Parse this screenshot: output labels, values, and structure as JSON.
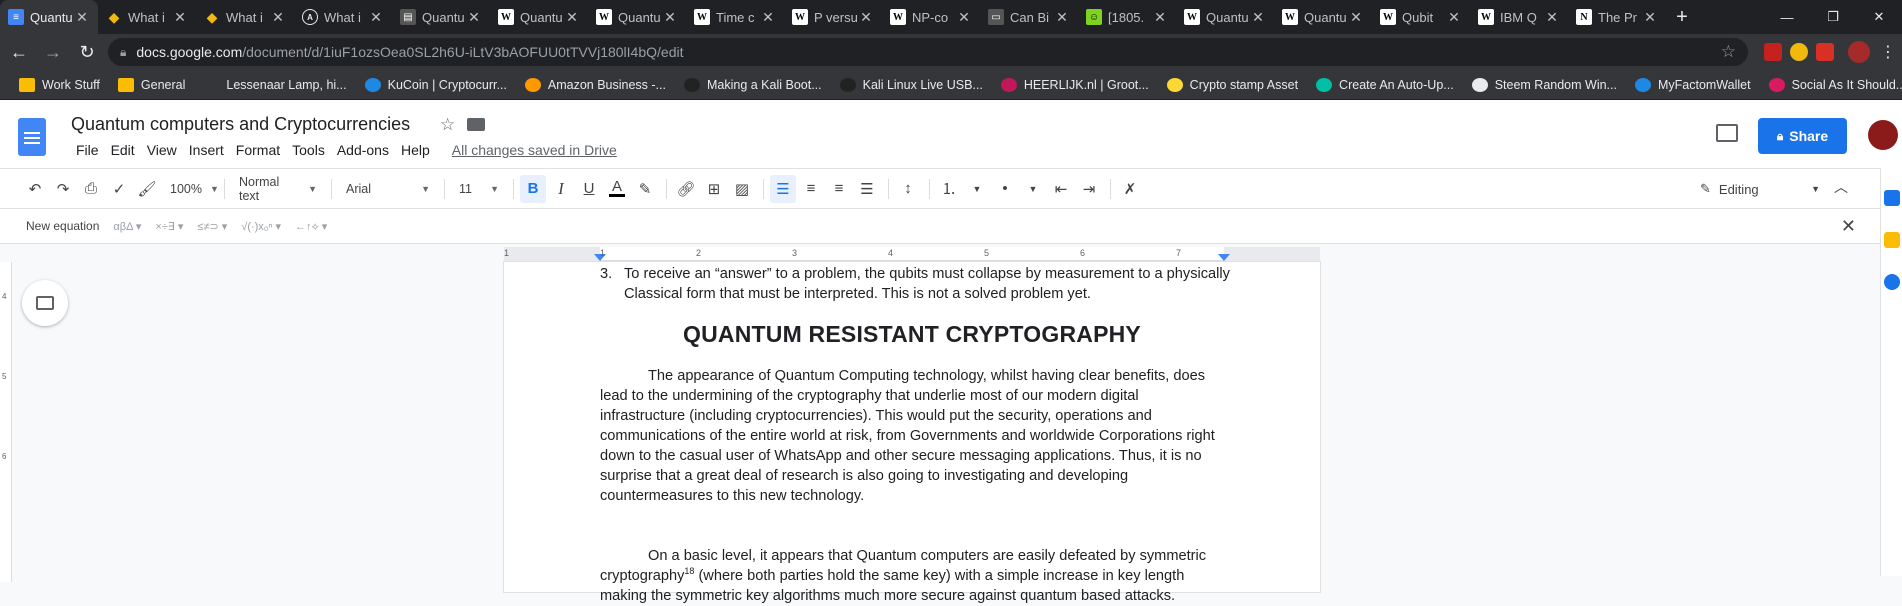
{
  "browser": {
    "tabs": [
      {
        "label": "Quantu",
        "icon": "docs-icon",
        "active": true
      },
      {
        "label": "What i",
        "icon": "binance-icon"
      },
      {
        "label": "What i",
        "icon": "binance-icon"
      },
      {
        "label": "What i",
        "icon": "circle-a-icon"
      },
      {
        "label": "Quantu",
        "icon": "page-icon"
      },
      {
        "label": "Quantu",
        "icon": "wikipedia-icon"
      },
      {
        "label": "Quantu",
        "icon": "wikipedia-icon"
      },
      {
        "label": "Time c",
        "icon": "wikipedia-icon"
      },
      {
        "label": "P versu",
        "icon": "wikipedia-icon"
      },
      {
        "label": "NP-co",
        "icon": "wikipedia-icon"
      },
      {
        "label": "Can Bi",
        "icon": "dark-icon"
      },
      {
        "label": "[1805.",
        "icon": "arxiv-icon"
      },
      {
        "label": "Quantu",
        "icon": "wikipedia-icon"
      },
      {
        "label": "Quantu",
        "icon": "wikipedia-icon"
      },
      {
        "label": "Qubit",
        "icon": "wikipedia-icon"
      },
      {
        "label": "IBM Q",
        "icon": "wikipedia-icon"
      },
      {
        "label": "The Pr",
        "icon": "n-icon"
      }
    ],
    "url_domain": "docs.google.com",
    "url_path": "/document/d/1iuF1ozsOea0SL2h6U-iLtV3bAOFUU0tTVVj180lI4bQ/edit",
    "bookmarks": [
      {
        "label": "Work Stuff",
        "color": "#fbbc04"
      },
      {
        "label": "General",
        "color": "#fbbc04"
      },
      {
        "label": "Lessenaar Lamp, hi...",
        "color": "#35363a"
      },
      {
        "label": "KuCoin | Cryptocurr...",
        "color": "#1e88e5"
      },
      {
        "label": "Amazon Business -...",
        "color": "#ff9900"
      },
      {
        "label": "Making a Kali Boot...",
        "color": "#222"
      },
      {
        "label": "Kali Linux Live USB...",
        "color": "#222"
      },
      {
        "label": "HEERLIJK.nl | Groot...",
        "color": "#c2185b"
      },
      {
        "label": "Crypto stamp Asset",
        "color": "#fdd835"
      },
      {
        "label": "Create An Auto-Up...",
        "color": "#00bfa5"
      },
      {
        "label": "Steem Random Win...",
        "color": "#e8eaed"
      },
      {
        "label": "MyFactomWallet",
        "color": "#1e88e5"
      },
      {
        "label": "Social As It Should...",
        "color": "#d81b60"
      }
    ]
  },
  "doc": {
    "title": "Quantum computers and Cryptocurrencies",
    "menu": [
      "File",
      "Edit",
      "View",
      "Insert",
      "Format",
      "Tools",
      "Add-ons",
      "Help"
    ],
    "saved_status": "All changes saved in Drive",
    "share_label": "Share"
  },
  "toolbar": {
    "zoom": "100%",
    "style": "Normal text",
    "font": "Arial",
    "size": "11",
    "bold": "B",
    "italic": "I",
    "underline": "U",
    "text_color": "A",
    "mode": "Editing"
  },
  "equation_bar": {
    "new_equation": "New equation",
    "groups": [
      "αβΔ ▾",
      "×÷∃ ▾",
      "≤≠⊃ ▾",
      "√(·)x₀ⁿ ▾",
      "←↑⟡ ▾"
    ]
  },
  "ruler": {
    "h_ticks": [
      "1",
      "1",
      "2",
      "3",
      "4",
      "5",
      "6",
      "7"
    ],
    "v_ticks": [
      "4",
      "5",
      "6"
    ]
  },
  "content": {
    "list_item_num": "3.",
    "list_item_text": "To receive an “answer” to a problem, the qubits must collapse by measurement to a physically Classical form that must be interpreted. This is not a solved problem yet.",
    "heading": "QUANTUM RESISTANT CRYPTOGRAPHY",
    "para1": "The appearance of Quantum Computing technology, whilst having clear benefits, does lead to the undermining of the cryptography that underlie most of our modern digital infrastructure (including cryptocurrencies). This would put the security, operations and communications of the entire world at risk, from Governments and worldwide Corporations right down to the casual user of WhatsApp and other secure messaging applications. Thus, it is no surprise that a great deal of research is also going to investigating and developing countermeasures to this new technology.",
    "para2_a": "On a basic level, it appears that Quantum computers are easily defeated by symmetric cryptography",
    "para2_sup": "18",
    "para2_b": " (where both parties hold the same key) with a simple increase in key length making the symmetric key algorithms much more secure against quantum based attacks."
  }
}
